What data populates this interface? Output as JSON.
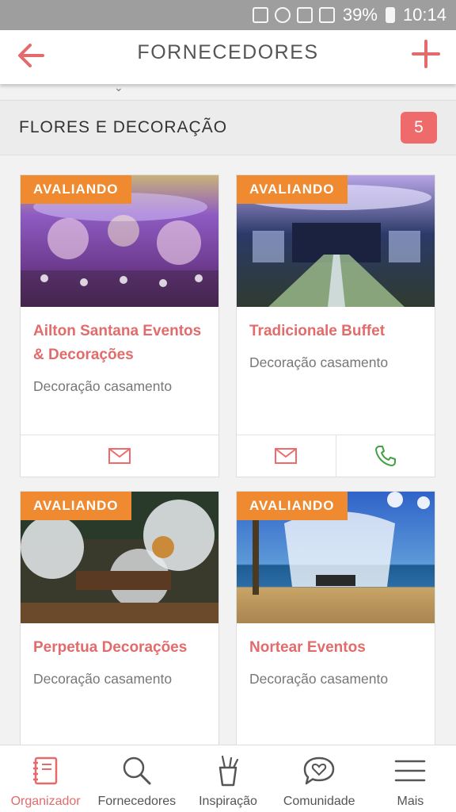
{
  "status_bar": {
    "battery": "39%",
    "time": "10:14"
  },
  "header": {
    "title": "FORNECEDORES"
  },
  "section": {
    "title": "FLORES E DECORAÇÃO",
    "count": "5"
  },
  "cards": [
    {
      "status": "AVALIANDO",
      "name": "Ailton Santana Eventos & Decorações",
      "category": "Decoração casamento",
      "actions": [
        "mail"
      ]
    },
    {
      "status": "AVALIANDO",
      "name": "Tradicionale Buffet",
      "category": "Decoração casamento",
      "actions": [
        "mail",
        "phone"
      ]
    },
    {
      "status": "AVALIANDO",
      "name": "Perpetua Decorações",
      "category": "Decoração casamento",
      "actions": []
    },
    {
      "status": "AVALIANDO",
      "name": "Nortear Eventos",
      "category": "Decoração casamento",
      "actions": []
    }
  ],
  "nav": {
    "items": [
      {
        "label": "Organizador",
        "icon": "notebook-icon",
        "active": true
      },
      {
        "label": "Fornecedores",
        "icon": "search-icon",
        "active": false
      },
      {
        "label": "Inspiração",
        "icon": "pencil-cup-icon",
        "active": false
      },
      {
        "label": "Comunidade",
        "icon": "heart-chat-icon",
        "active": false
      },
      {
        "label": "Mais",
        "icon": "menu-icon",
        "active": false
      }
    ]
  },
  "colors": {
    "accent": "#e36b6b",
    "badge": "#ef6b6b",
    "tag": "#ef8a31",
    "phone": "#43a047"
  }
}
